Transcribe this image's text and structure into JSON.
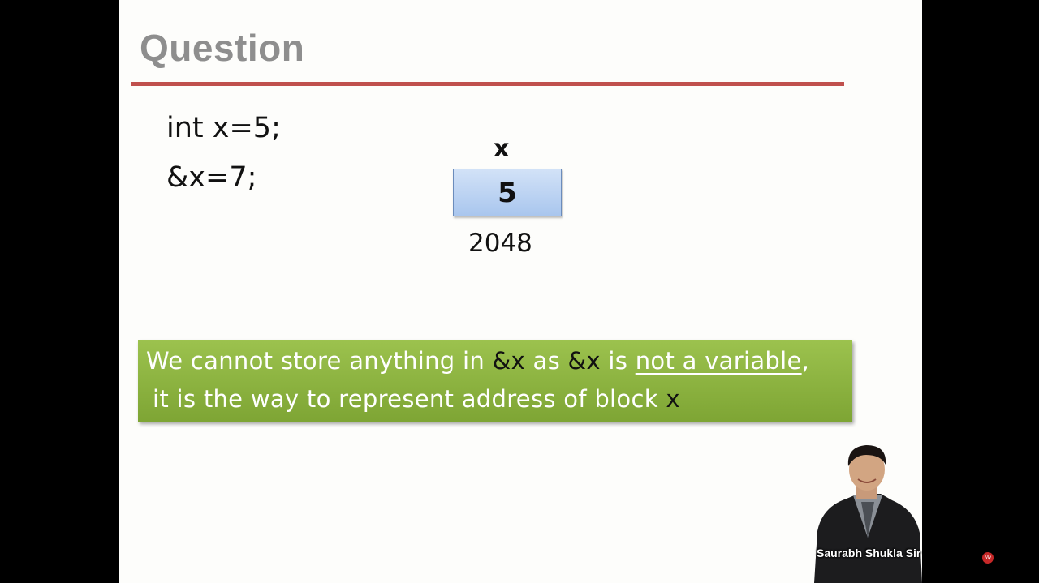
{
  "slide": {
    "title": "Question",
    "code_lines": [
      "int x=5;",
      "&x=7;"
    ]
  },
  "memory_diagram": {
    "variable_name": "x",
    "value": "5",
    "address": "2048"
  },
  "note": {
    "line1_part1": "We cannot store anything in ",
    "line1_code1": "&x",
    "line1_part2": " as ",
    "line1_code2": "&x",
    "line1_part3": " is ",
    "line1_emphasis": "not a variable",
    "line1_part4": ",",
    "line2_part1": "it is the way to represent address of block ",
    "line2_code": "x"
  },
  "presenter": {
    "name": "Saurabh Shukla Sir"
  },
  "colors": {
    "title_rule": "#c0504d",
    "memory_block": "#b8d0f0",
    "note_background": "#8cb443"
  }
}
